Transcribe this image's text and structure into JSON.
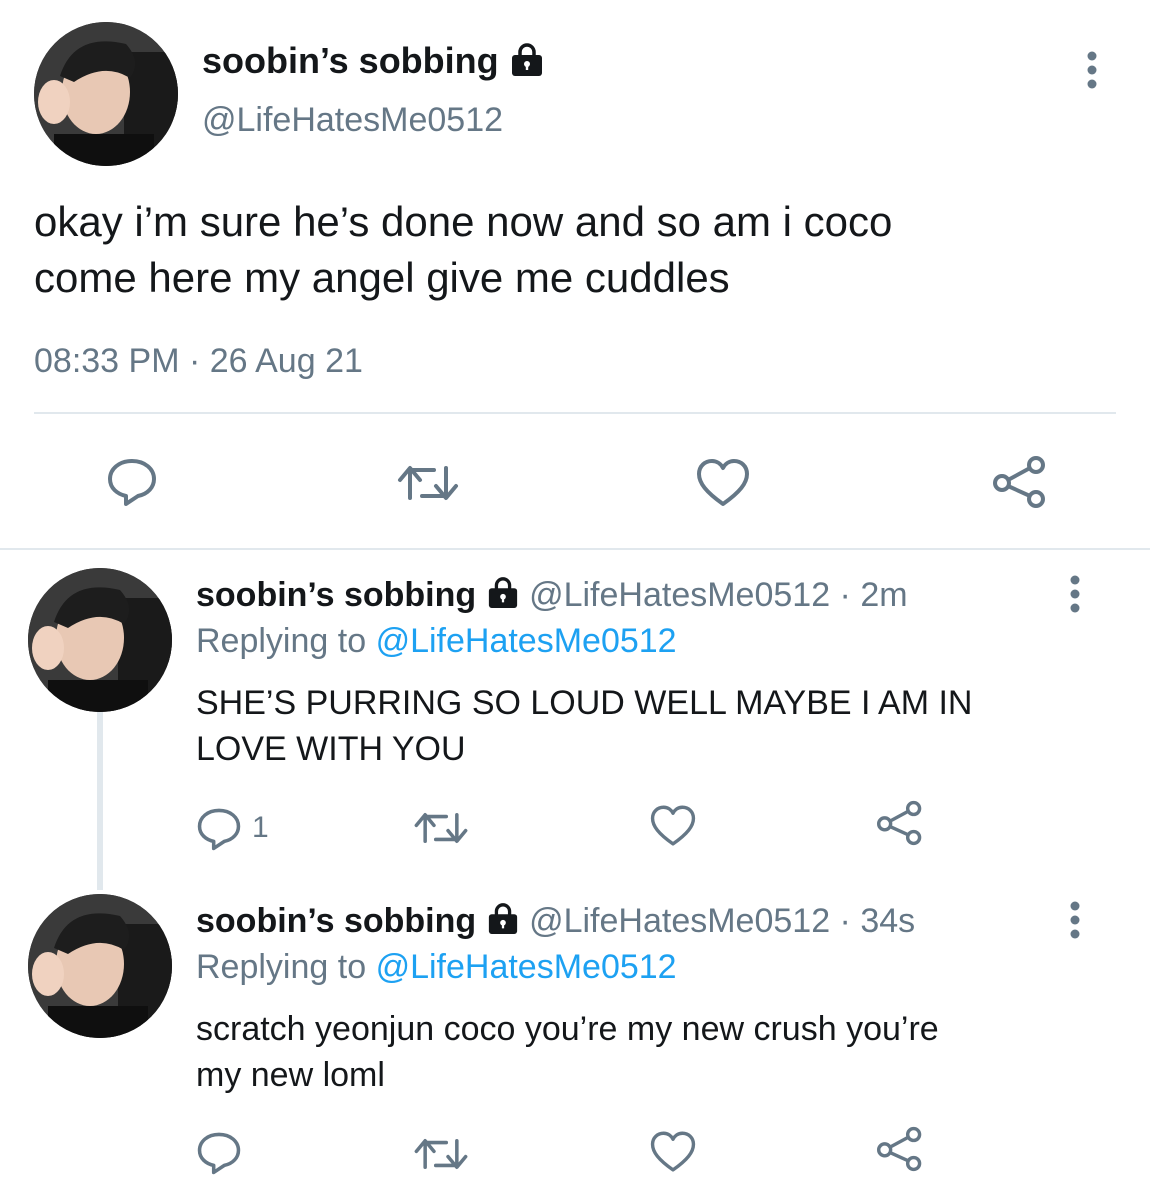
{
  "main_tweet": {
    "display_name": "soobin’s sobbing",
    "handle": "@LifeHatesMe0512",
    "text_line1": "okay i’m sure he’s done now and so am i coco",
    "text_line2": "come here my angel give me cuddles",
    "timestamp": "08:33 PM · 26 Aug 21",
    "icons": [
      "reply-icon",
      "retweet-icon",
      "like-icon",
      "share-icon"
    ]
  },
  "replies": [
    {
      "display_name": "soobin’s sobbing",
      "meta": "@LifeHatesMe0512 · 2m",
      "replying_prefix": "Replying to",
      "replying_handle": "@LifeHatesMe0512",
      "text_line1": "SHE’S PURRING SO LOUD WELL MAYBE I AM IN",
      "text_line2": "LOVE WITH YOU",
      "reply_count": "1"
    },
    {
      "display_name": "soobin’s sobbing",
      "meta": "@LifeHatesMe0512 · 34s",
      "replying_prefix": "Replying to",
      "replying_handle": "@LifeHatesMe0512",
      "text_line1": "scratch yeonjun coco you’re my new crush you’re",
      "text_line2": "my new loml",
      "reply_count": ""
    }
  ],
  "colors": {
    "text": "#14171a",
    "secondary": "#657786",
    "link": "#1da1f2",
    "divider": "#e1e8ed"
  }
}
